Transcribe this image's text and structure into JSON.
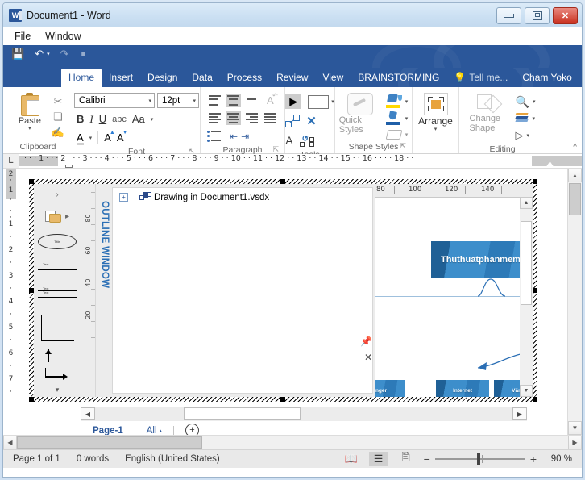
{
  "window": {
    "title": "Document1 - Word",
    "app_icon": "word-icon",
    "controls": {
      "minimize": "–",
      "restore": "❐",
      "close": "✕"
    }
  },
  "menubar": {
    "items": [
      "File",
      "Window"
    ]
  },
  "quick_access": {
    "save": "save-icon",
    "undo": "undo-icon",
    "redo": "redo-icon",
    "customize": "customize-icon"
  },
  "ribbon": {
    "tabs": [
      {
        "label": "Home",
        "active": true
      },
      {
        "label": "Insert",
        "active": false
      },
      {
        "label": "Design",
        "active": false
      },
      {
        "label": "Data",
        "active": false
      },
      {
        "label": "Process",
        "active": false
      },
      {
        "label": "Review",
        "active": false
      },
      {
        "label": "View",
        "active": false
      },
      {
        "label": "BRAINSTORMING",
        "active": false
      }
    ],
    "tell_me": "Tell me...",
    "account": "Cham Yoko",
    "collapse": "^",
    "groups": {
      "clipboard": {
        "label": "Clipboard",
        "paste": "Paste",
        "paste_caret": "▾",
        "cut": "✂",
        "copy": "❏",
        "format_painter": "🖌"
      },
      "font": {
        "label": "Font",
        "font_name": "Calibri",
        "font_size": "12pt",
        "bold": "B",
        "italic": "I",
        "underline": "U",
        "strikethrough": "abc",
        "change_case": "Aa",
        "font_color": "A",
        "grow_font": "A",
        "shrink_font": "A",
        "dialog_launcher": "⌐"
      },
      "paragraph": {
        "label": "Paragraph",
        "dialog_launcher": "⌐",
        "align_top": "align-top",
        "align_middle": "align-middle",
        "align_bottom": "align-bottom",
        "text_direction": "A",
        "align_left": "align-left",
        "align_center": "align-center",
        "align_right": "align-right",
        "align_justify": "align-justify",
        "bullets": "bullets",
        "decrease_indent": "⇤",
        "increase_indent": "⇥"
      },
      "tools": {
        "label": "Tools",
        "pointer": "pointer-tool",
        "rectangle": "rectangle-tool",
        "rectangle_caret": "▾",
        "connector": "connector-tool",
        "delete": "✕",
        "text": "A",
        "crop": "crop-tool"
      },
      "shape_styles": {
        "label": "Shape Styles",
        "quick_styles": "Quick Styles",
        "quick_styles_caret": "▾",
        "fill": "fill-bucket",
        "fill_caret": "▾",
        "line": "line-pen",
        "line_caret": "▾",
        "effects": "effects",
        "effects_caret": "▾",
        "dialog_launcher": "⌐"
      },
      "arrange": {
        "label": "",
        "name": "Arrange",
        "caret": "▾"
      },
      "editing": {
        "label": "Editing",
        "change_shape": "Change Shape",
        "change_shape_caret": "▾",
        "find": "find-icon",
        "find_caret": "▾",
        "layers": "layers-icon",
        "layers_caret": "▾",
        "select": "select-icon",
        "select_caret": "▾"
      }
    }
  },
  "ruler": {
    "tab_selector": "L",
    "horizontal_marks": "·  ·  ·  1  ·  ·  ·  2  ·  ·  ·  3  ·  ·  ·  4  ·  ·  ·  5  ·  ·  ·  6  ·  ·  ·  7  ·  ·  ·  8  ·  ·  ·  9  ·  · 10 ·  · 11 ·  · 12 ·  · 13 ·  · 14 ·  · 15 ·  · 16 ·  ·  ·  · 18 ·  ·",
    "vertical_ticks": [
      "2",
      "1",
      "1",
      "2",
      "3",
      "4",
      "5",
      "6",
      "7"
    ]
  },
  "embedded_object": {
    "type": "visio-drawing",
    "outline_window": {
      "label": "OUTLINE WINDOW",
      "pin": "pin-icon",
      "close": "✕",
      "tree": [
        {
          "expander": "+",
          "icon": "visio-diagram-icon",
          "label": "Drawing in Document1.vsdx"
        }
      ]
    },
    "canvas": {
      "ruler_marks": [
        "80",
        "100",
        "120",
        "140"
      ],
      "nodes": [
        {
          "label": "Thuthuatphanmem.",
          "size": "large"
        },
        {
          "label": "nger",
          "size": "small"
        },
        {
          "label": "Internet",
          "size": "small"
        },
        {
          "label": "Văn p",
          "size": "small"
        }
      ]
    },
    "shapes_panel": {
      "expander": "›",
      "more_shapes": "more-shapes-icon",
      "stencil_items": [
        "ellipse-shape",
        "line-shape",
        "double-line-shape",
        "corner-shape",
        "arrow-shape",
        "dashed-arrow-shape"
      ],
      "scroll_down": "▾"
    },
    "vertical_ruler_ticks": [
      "80",
      "60",
      "40",
      "20"
    ],
    "page_tabs": {
      "pages": [
        "Page-1"
      ],
      "all_label": "All",
      "all_caret": "▴",
      "insert_page": "+"
    },
    "hscroll": {
      "left": "◀",
      "right": "▶"
    }
  },
  "status_bar": {
    "page": "Page 1 of 1",
    "words": "0 words",
    "language": "English (United States)",
    "views": [
      {
        "name": "read-mode-view",
        "active": false
      },
      {
        "name": "print-layout-view",
        "active": true
      },
      {
        "name": "web-layout-view",
        "active": false
      }
    ],
    "zoom_out": "−",
    "zoom_in": "+",
    "zoom_level": "90 %"
  },
  "colors": {
    "ribbon_blue": "#2b579a",
    "accent_blue": "#2b6fb5",
    "node_blue": "#3d8ecb",
    "close_red": "#c9301f"
  }
}
